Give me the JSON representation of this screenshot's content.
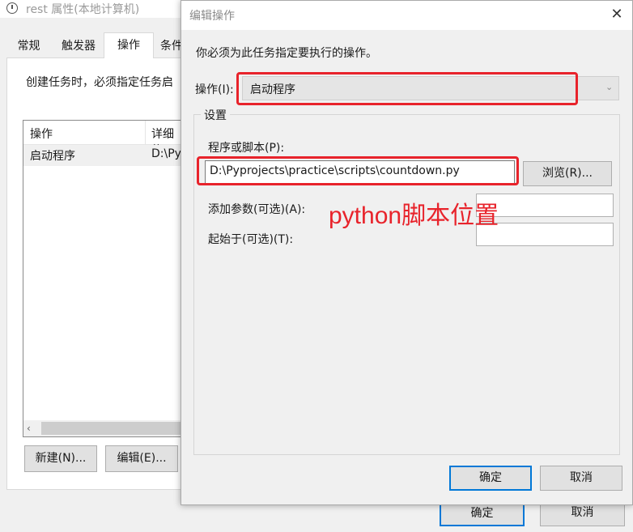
{
  "background_window": {
    "title": "rest 属性(本地计算机)",
    "tabs": [
      "常规",
      "触发器",
      "操作",
      "条件"
    ],
    "description": "创建任务时，必须指定任务启",
    "list_headers": {
      "action": "操作",
      "details": "详细信"
    },
    "list_rows": [
      {
        "action": "启动程序",
        "details": "D:\\Py"
      }
    ],
    "buttons": {
      "new": "新建(N)...",
      "edit": "编辑(E)...",
      "ok": "确定",
      "cancel": "取消"
    }
  },
  "dialog": {
    "title": "编辑操作",
    "close_glyph": "✕",
    "instruction": "你必须为此任务指定要执行的操作。",
    "action_label": "操作(I):",
    "action_value": "启动程序",
    "settings_legend": "设置",
    "program_label": "程序或脚本(P):",
    "program_value": "D:\\Pyprojects\\practice\\scripts\\countdown.py",
    "browse_button": "浏览(R)...",
    "arguments_label": "添加参数(可选)(A):",
    "arguments_value": "",
    "start_in_label": "起始于(可选)(T):",
    "start_in_value": "",
    "ok_button": "确定",
    "cancel_button": "取消"
  },
  "annotation": {
    "text": "python脚本位置",
    "color": "#e8232b"
  },
  "icons": {
    "window_icon": "clock-icon",
    "close": "close-icon",
    "dropdown": "chevron-down-icon"
  },
  "colors": {
    "accent": "#0078d7",
    "highlight": "#e8232b"
  }
}
